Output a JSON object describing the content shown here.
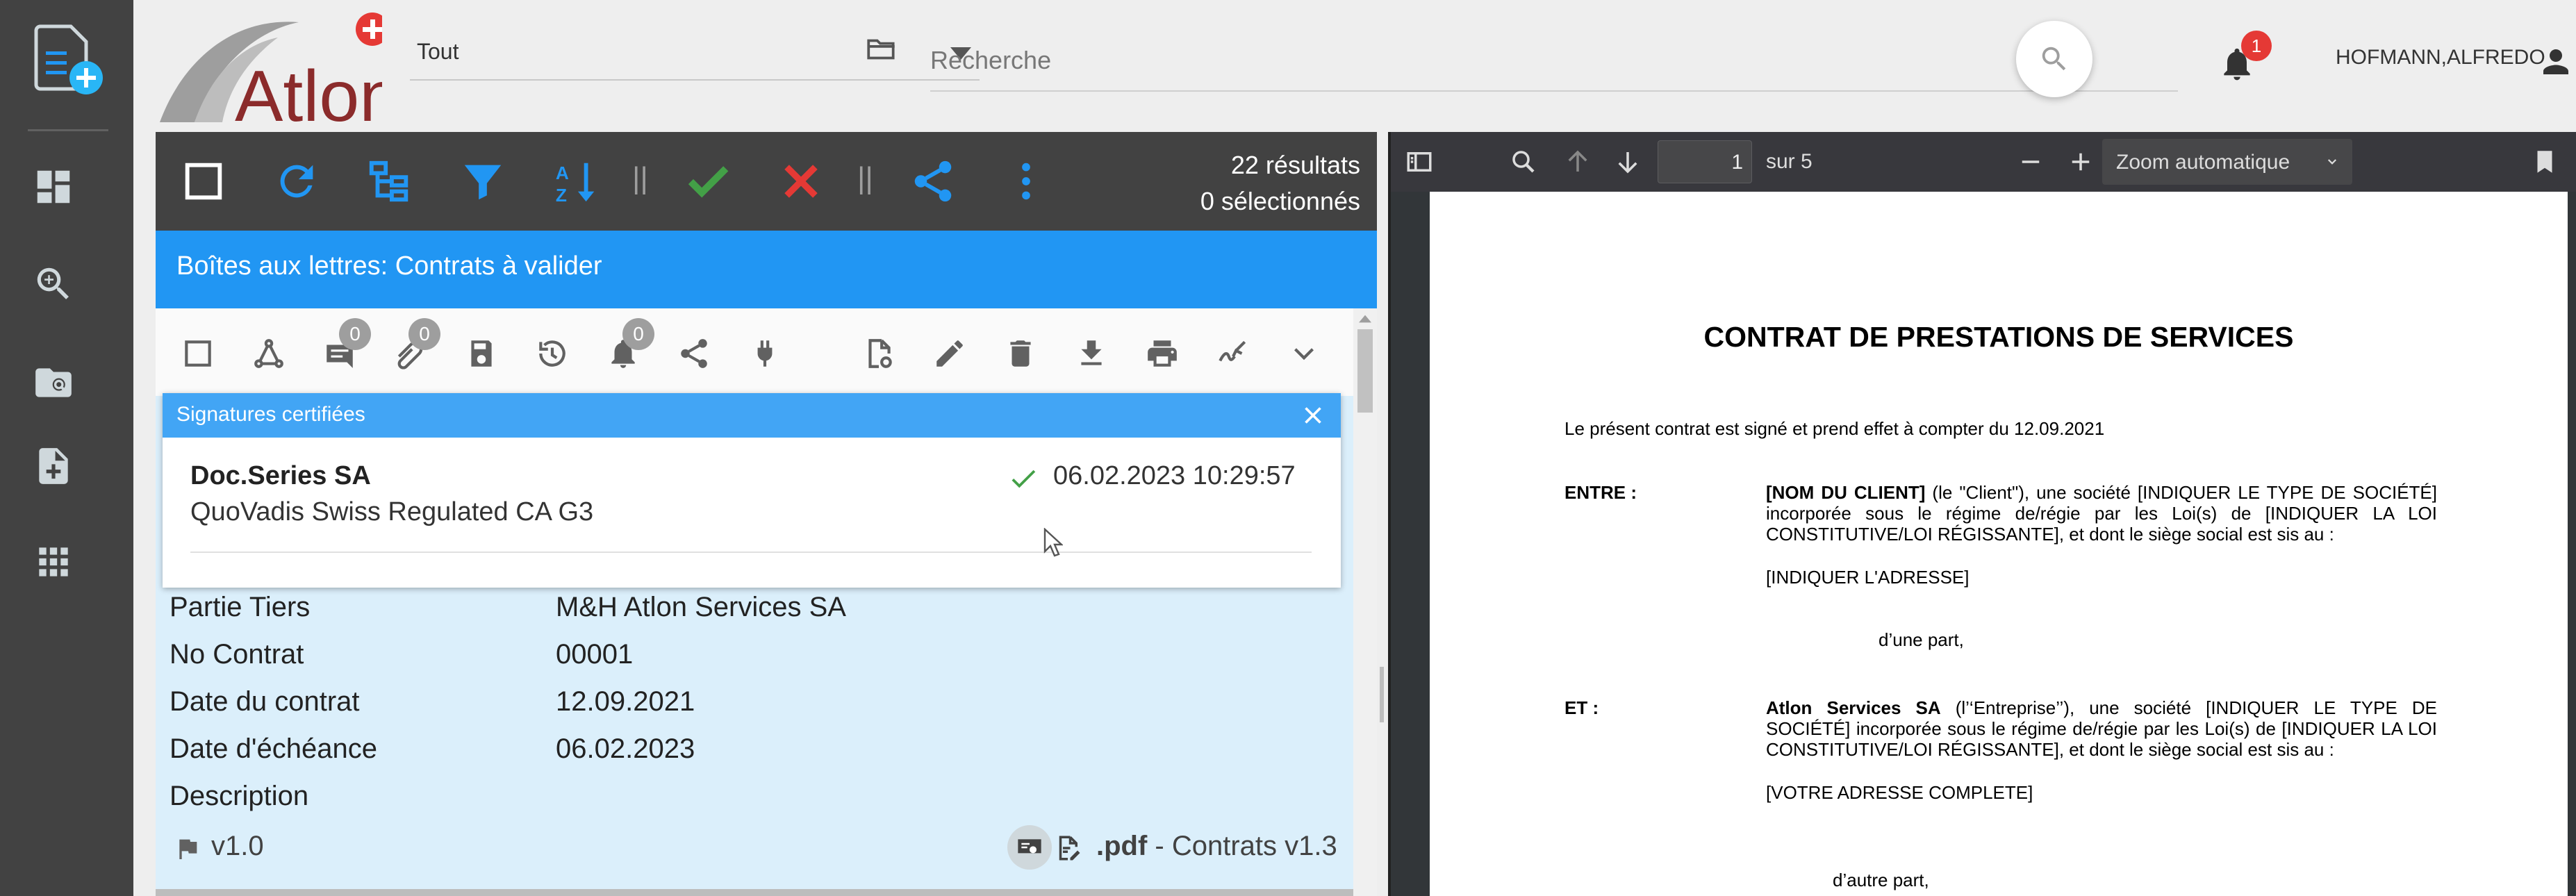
{
  "header": {
    "scope_select": "Tout",
    "search_placeholder": "Recherche",
    "notifications_count": "1",
    "user_name": "HOFMANN,ALFREDO",
    "logo_text": "Atlon"
  },
  "toolbar": {
    "results": "22 résultats",
    "selected": "0 sélectionnés",
    "separator": "||"
  },
  "mailbox": {
    "title": "Boîtes aux lettres: Contrats à valider"
  },
  "document": {
    "comments_count": "0",
    "attachments_count": "0",
    "alerts_count": "0",
    "signatures_title": "Signatures certifiées",
    "signer_name": "Doc.Series SA",
    "signer_ca": "QuoVadis Swiss Regulated CA G3",
    "signature_date": "06.02.2023 10:29:57",
    "properties": [
      {
        "label": "Partie Tiers",
        "value": "M&H Atlon Services SA"
      },
      {
        "label": "No Contrat",
        "value": "00001"
      },
      {
        "label": "Date du contrat",
        "value": "12.09.2021"
      },
      {
        "label": "Date d'échéance",
        "value": "06.02.2023"
      },
      {
        "label": "Description",
        "value": ""
      }
    ],
    "version": "v1.0",
    "format": ".pdf",
    "doc_type": " - Contrats v1.3"
  },
  "viewer": {
    "page_number": "1",
    "page_total": "sur 5",
    "zoom": "Zoom automatique",
    "pdf": {
      "title": "CONTRAT DE PRESTATIONS DE SERVICES",
      "intro": "Le présent contrat est signé et prend effet à compter du 12.09.2021",
      "entre_label": "ENTRE :",
      "entre_bold": "[NOM DU CLIENT]",
      "entre_text1": " (le \"Client\"), une société [INDIQUER LE TYPE DE SOCIÉTÉ] incorporée sous le régime de/régie par les Loi(s) de [INDIQUER LA LOI CONSTITUTIVE/LOI RÉGISSANTE], et dont le siège social est sis au :",
      "client_address": "[INDIQUER L'ADRESSE]",
      "first_part": "d’une part,",
      "et_label": "ET :",
      "et_bold": "Atlon Services SA",
      "et_text1": " (l’‘Entreprise’’), une société [INDIQUER LE TYPE DE SOCIÉTÉ] incorporée sous le régime de/régie par les Loi(s) de [INDIQUER LA LOI CONSTITUTIVE/LOI RÉGISSANTE], et dont le siège social est sis au :",
      "company_address": "[VOTRE ADRESSE COMPLETE]",
      "second_part": "d’autre part,"
    }
  },
  "colors": {
    "rail": "#424242",
    "toolbar": "#424242",
    "mailbox": "#2196f3",
    "sig_header": "#42a5f5",
    "check": "#43a047",
    "cross": "#e53935",
    "icon_blue": "#2196f3",
    "notification": "#e53935"
  }
}
